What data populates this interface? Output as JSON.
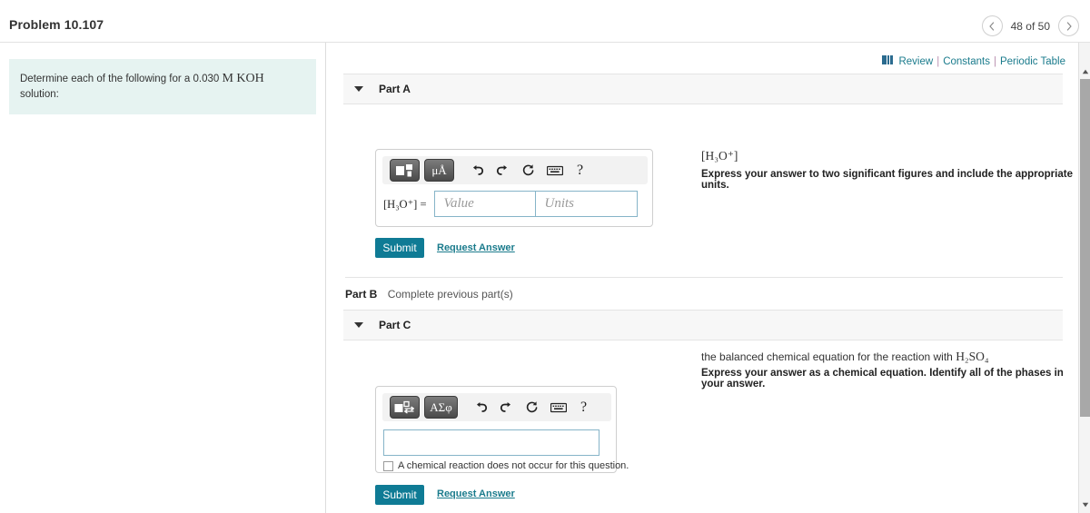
{
  "top_strip": {
    "fragments": [
      "",
      "",
      "",
      ""
    ]
  },
  "header": {
    "title": "Problem 10.107",
    "nav": {
      "prev_icon": "chevron-left-icon",
      "next_icon": "chevron-right-icon",
      "counter": "48 of 50"
    }
  },
  "problem": {
    "text_before": "Determine each of the following for a 0.030",
    "concentration_unit": "M KOH",
    "text_after": "solution:"
  },
  "utility_links": {
    "book_icon": "book-icon",
    "review": "Review",
    "separator": "|",
    "constants": "Constants",
    "periodic_table": "Periodic Table"
  },
  "parts": {
    "part_a": {
      "label": "Part A",
      "caret_icon": "caret-down-icon",
      "question": "[H₃O⁺]",
      "instruction": "Express your answer to two significant figures and include the appropriate units.",
      "toolbar": {
        "template_button": "template-icon",
        "units_button": "μÅ",
        "undo_icon": "undo-icon",
        "redo_icon": "redo-icon",
        "reset_icon": "reset-icon",
        "keyboard_icon": "keyboard-icon",
        "help_label": "?"
      },
      "answer_prefix": "[H₃O⁺] =",
      "value_placeholder": "Value",
      "units_placeholder": "Units",
      "submit_label": "Submit",
      "request_label": "Request Answer"
    },
    "part_b": {
      "label": "Part B",
      "note": "Complete previous part(s)"
    },
    "part_c": {
      "label": "Part C",
      "caret_icon": "caret-down-icon",
      "question_before": "the balanced chemical equation for the reaction with",
      "question_formula": "H₂SO₄",
      "instruction": "Express your answer as a chemical equation. Identify all of the phases in your answer.",
      "toolbar": {
        "template_button": "chem-equation-icon",
        "symbols_button": "ΑΣφ",
        "undo_icon": "undo-icon",
        "redo_icon": "redo-icon",
        "reset_icon": "reset-icon",
        "keyboard_icon": "keyboard-icon",
        "help_label": "?"
      },
      "input_value": "",
      "checkbox_label": "A chemical reaction does not occur for this question.",
      "checkbox_checked": false,
      "submit_label": "Submit",
      "request_label": "Request Answer"
    }
  },
  "scrollbar": {
    "up_icon": "scroll-up-icon",
    "down_icon": "scroll-down-icon"
  },
  "colors": {
    "accent_teal": "#0f7b95",
    "link_teal": "#1a7b8c",
    "problem_bg": "#e6f3f1",
    "field_border": "#86b4c8",
    "panel_bg": "#f7f7f7"
  }
}
